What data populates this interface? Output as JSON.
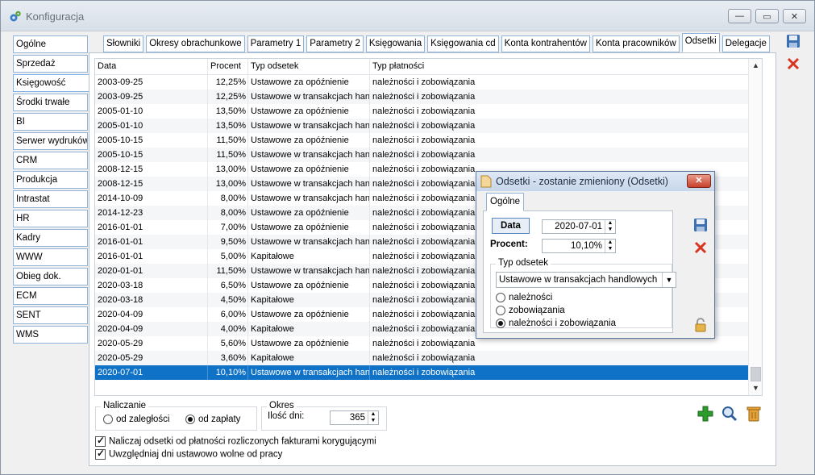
{
  "window": {
    "title": "Konfiguracja",
    "btn_min": "—",
    "btn_max": "▭",
    "btn_close": "✕"
  },
  "nav": [
    "Ogólne",
    "Sprzedaż",
    "Księgowość",
    "Środki trwałe",
    "BI",
    "Serwer wydruków",
    "CRM",
    "Produkcja",
    "Intrastat",
    "HR",
    "Kadry",
    "WWW",
    "Obieg dok.",
    "ECM",
    "SENT",
    "WMS"
  ],
  "nav_active": "Księgowość",
  "tabs": [
    "Słowniki",
    "Okresy obrachunkowe",
    "Parametry 1",
    "Parametry 2",
    "Księgowania",
    "Księgowania cd",
    "Konta kontrahentów",
    "Konta pracowników",
    "Odsetki",
    "Delegacje"
  ],
  "tab_active": "Odsetki",
  "grid": {
    "headers": {
      "date": "Data",
      "pct": "Procent",
      "type": "Typ odsetek",
      "pay": "Typ płatności"
    },
    "rows": [
      [
        "2003-09-25",
        "12,25%",
        "Ustawowe za opóźnienie",
        "należności i zobowiązania"
      ],
      [
        "2003-09-25",
        "12,25%",
        "Ustawowe w transakcjach handlowych",
        "należności i zobowiązania"
      ],
      [
        "2005-01-10",
        "13,50%",
        "Ustawowe za opóźnienie",
        "należności i zobowiązania"
      ],
      [
        "2005-01-10",
        "13,50%",
        "Ustawowe w transakcjach handlowych",
        "należności i zobowiązania"
      ],
      [
        "2005-10-15",
        "11,50%",
        "Ustawowe za opóźnienie",
        "należności i zobowiązania"
      ],
      [
        "2005-10-15",
        "11,50%",
        "Ustawowe w transakcjach handlowych",
        "należności i zobowiązania"
      ],
      [
        "2008-12-15",
        "13,00%",
        "Ustawowe za opóźnienie",
        "należności i zobowiązania"
      ],
      [
        "2008-12-15",
        "13,00%",
        "Ustawowe w transakcjach handlowych",
        "należności i zobowiązania"
      ],
      [
        "2014-10-09",
        "8,00%",
        "Ustawowe w transakcjach handlowych",
        "należności i zobowiązania"
      ],
      [
        "2014-12-23",
        "8,00%",
        "Ustawowe za opóźnienie",
        "należności i zobowiązania"
      ],
      [
        "2016-01-01",
        "7,00%",
        "Ustawowe za opóźnienie",
        "należności i zobowiązania"
      ],
      [
        "2016-01-01",
        "9,50%",
        "Ustawowe w transakcjach handlowych",
        "należności i zobowiązania"
      ],
      [
        "2016-01-01",
        "5,00%",
        "Kapitałowe",
        "należności i zobowiązania"
      ],
      [
        "2020-01-01",
        "11,50%",
        "Ustawowe w transakcjach handlowych",
        "należności i zobowiązania"
      ],
      [
        "2020-03-18",
        "6,50%",
        "Ustawowe za opóźnienie",
        "należności i zobowiązania"
      ],
      [
        "2020-03-18",
        "4,50%",
        "Kapitałowe",
        "należności i zobowiązania"
      ],
      [
        "2020-04-09",
        "6,00%",
        "Ustawowe za opóźnienie",
        "należności i zobowiązania"
      ],
      [
        "2020-04-09",
        "4,00%",
        "Kapitałowe",
        "należności i zobowiązania"
      ],
      [
        "2020-05-29",
        "5,60%",
        "Ustawowe za opóźnienie",
        "należności i zobowiązania"
      ],
      [
        "2020-05-29",
        "3,60%",
        "Kapitałowe",
        "należności i zobowiązania"
      ],
      [
        "2020-07-01",
        "10,10%",
        "Ustawowe w transakcjach handlowych",
        "należności i zobowiązania"
      ]
    ],
    "selected_index": 20
  },
  "naliczanie": {
    "title": "Naliczanie",
    "opt1": "od zaległości",
    "opt2": "od zapłaty",
    "selected": "od zapłaty"
  },
  "okres": {
    "title": "Okres",
    "label": "Ilość dni:",
    "value": "365"
  },
  "checks": [
    {
      "label": "Naliczaj odsetki od płatności rozliczonych fakturami korygującymi",
      "checked": true
    },
    {
      "label": "Uwzględniaj dni ustawowo wolne od pracy",
      "checked": true
    }
  ],
  "dialog": {
    "title": "Odsetki - zostanie zmieniony  (Odsetki)",
    "close": "✕",
    "tab": "Ogólne",
    "data_label": "Data",
    "data_value": "2020-07-01",
    "pct_label": "Procent:",
    "pct_value": "10,10%",
    "type_group": "Typ odsetek",
    "type_value": "Ustawowe w transakcjach handlowych",
    "opts": [
      "należności",
      "zobowiązania",
      "należności i zobowiązania"
    ],
    "opt_selected": "należności i zobowiązania"
  },
  "colors": {
    "selection": "#0f72c6",
    "accent_green": "#2e9a2e",
    "accent_red": "#d9341f"
  }
}
